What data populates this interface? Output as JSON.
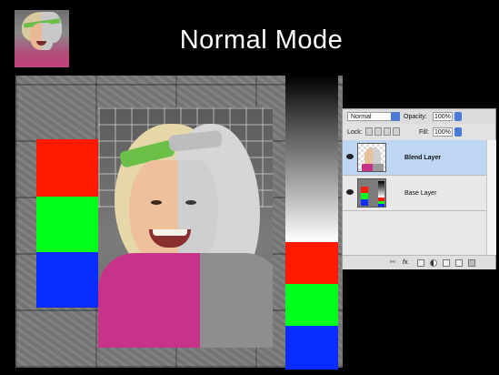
{
  "slide": {
    "title": "Normal Mode"
  },
  "colors": {
    "background": "#000000",
    "red": "#ff1a00",
    "green": "#00ff1a",
    "blue": "#0a2dff",
    "selected_layer": "#bcd6f4"
  },
  "layers_panel": {
    "blend_mode": "Normal",
    "opacity_label": "Opacity:",
    "opacity_value": "100%",
    "lock_label": "Lock:",
    "fill_label": "Fill:",
    "fill_value": "100%",
    "layers": [
      {
        "name": "Blend Layer",
        "selected": true,
        "visible": true
      },
      {
        "name": "Base Layer",
        "selected": false,
        "visible": true
      }
    ],
    "lock_icons": [
      "lock-transparency-icon",
      "lock-paint-icon",
      "lock-move-icon",
      "lock-all-icon"
    ],
    "bottom_icons": [
      "link-icon",
      "fx-icon",
      "mask-icon",
      "adjustment-icon",
      "group-icon",
      "new-layer-icon",
      "trash-icon"
    ],
    "bottom_fx_label": "fx."
  }
}
